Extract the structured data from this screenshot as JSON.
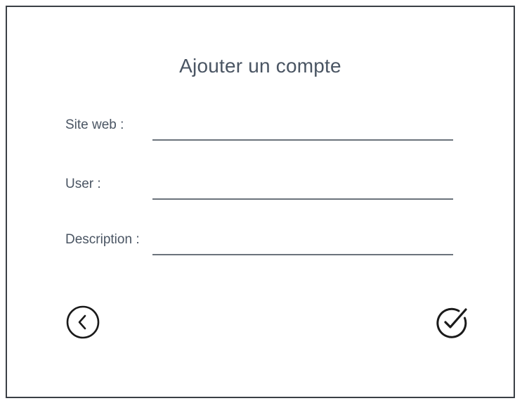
{
  "dialog": {
    "title": "Ajouter un compte"
  },
  "form": {
    "fields": [
      {
        "label": "Site web :",
        "value": "",
        "placeholder": ""
      },
      {
        "label": "User :",
        "value": "",
        "placeholder": ""
      },
      {
        "label": "Description :",
        "value": "",
        "placeholder": ""
      }
    ]
  },
  "actions": {
    "back_icon": "chevron-left-circle-icon",
    "confirm_icon": "check-circle-icon"
  },
  "colors": {
    "text": "#4a5563",
    "border": "#3a3f45",
    "icon": "#1a1a1a",
    "underline": "#6b737c"
  }
}
